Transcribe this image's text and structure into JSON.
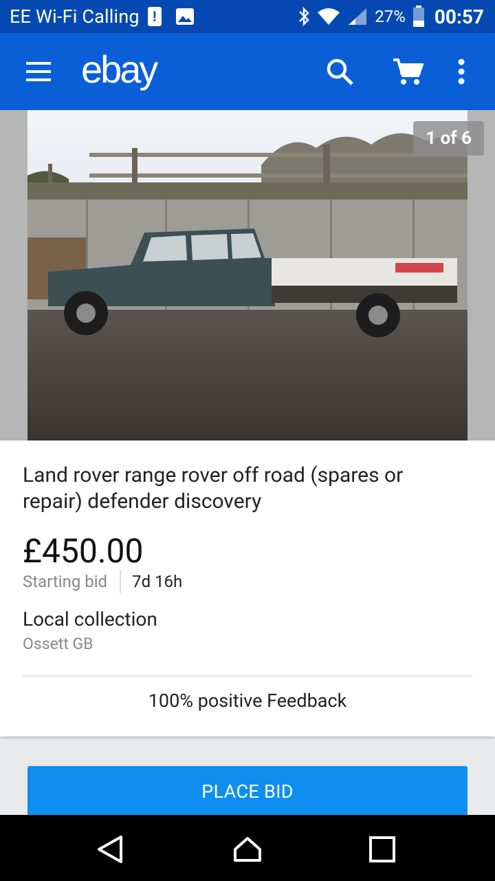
{
  "status_bar": {
    "carrier": "EE Wi-Fi Calling",
    "alert_glyph": "!",
    "battery_pct": "27%",
    "time": "00:57",
    "icons": [
      "alert-icon",
      "image-icon",
      "bluetooth-icon",
      "wifi-icon",
      "signal-icon",
      "battery-icon"
    ]
  },
  "app_bar": {
    "logo": "ebay",
    "background": "#0a5fd6",
    "icons": [
      "menu-icon",
      "search-icon",
      "cart-icon",
      "more-vert-icon"
    ]
  },
  "gallery": {
    "counter": "1 of 6"
  },
  "listing": {
    "title": "Land rover range rover off road (spares or repair) defender discovery",
    "price": "£450.00",
    "bid_label": "Starting bid",
    "time_left": "7d 16h",
    "delivery": "Local collection",
    "location": "Ossett GB",
    "feedback": "100% positive Feedback"
  },
  "actions": {
    "place_bid": "PLACE BID",
    "button_color": "#0e8ff0"
  },
  "nav_bar": {
    "icons": [
      "back-icon",
      "home-icon",
      "recents-icon"
    ]
  }
}
